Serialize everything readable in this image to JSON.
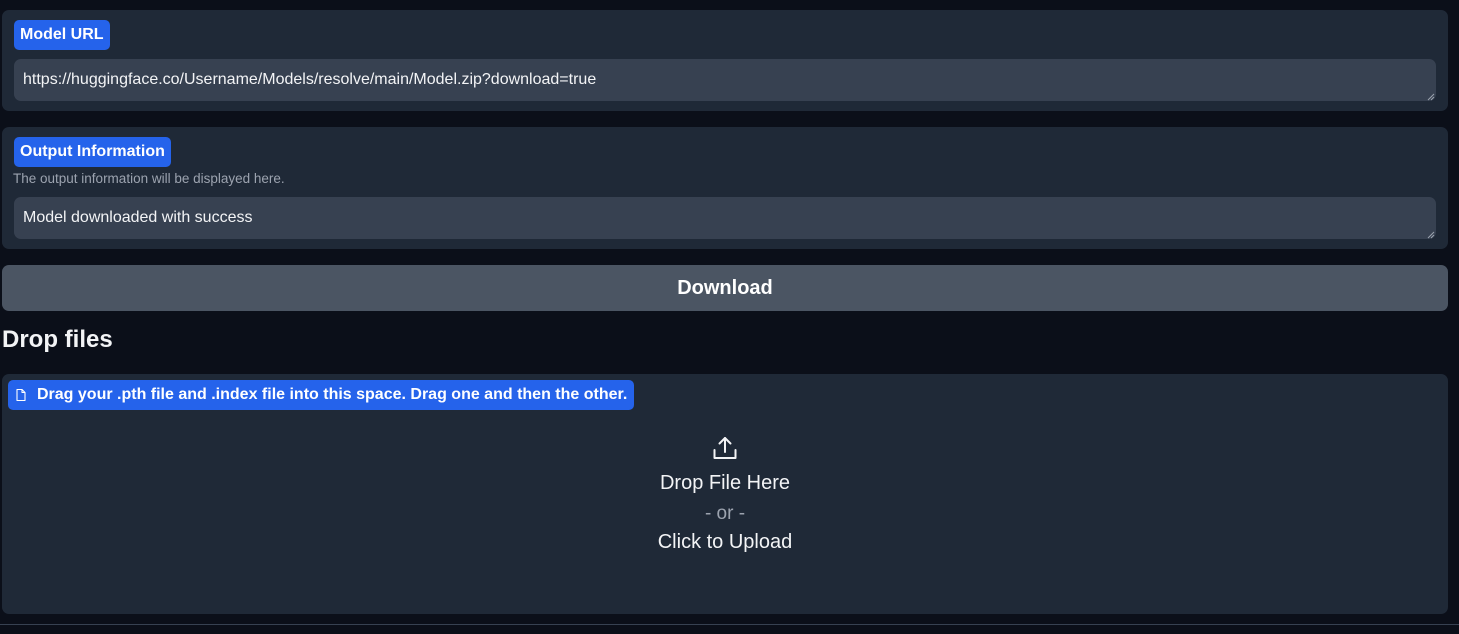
{
  "model_url": {
    "label": "Model URL",
    "value": "https://huggingface.co/Username/Models/resolve/main/Model.zip?download=true"
  },
  "output_information": {
    "label": "Output Information",
    "info": "The output information will be displayed here.",
    "value": "Model downloaded with success"
  },
  "download_button": {
    "label": "Download"
  },
  "drop_files": {
    "title": "Drop files",
    "chip_label": "Drag your .pth file and .index file into this space. Drag one and then the other.",
    "chip_icon": "file-icon",
    "upload_icon": "upload-icon",
    "drop_text": "Drop File Here",
    "or_text": "- or -",
    "click_text": "Click to Upload"
  },
  "colors": {
    "background": "#0b0f19",
    "panel": "#1f2937",
    "input": "#374151",
    "accent": "#2563eb",
    "button": "#4b5563"
  }
}
